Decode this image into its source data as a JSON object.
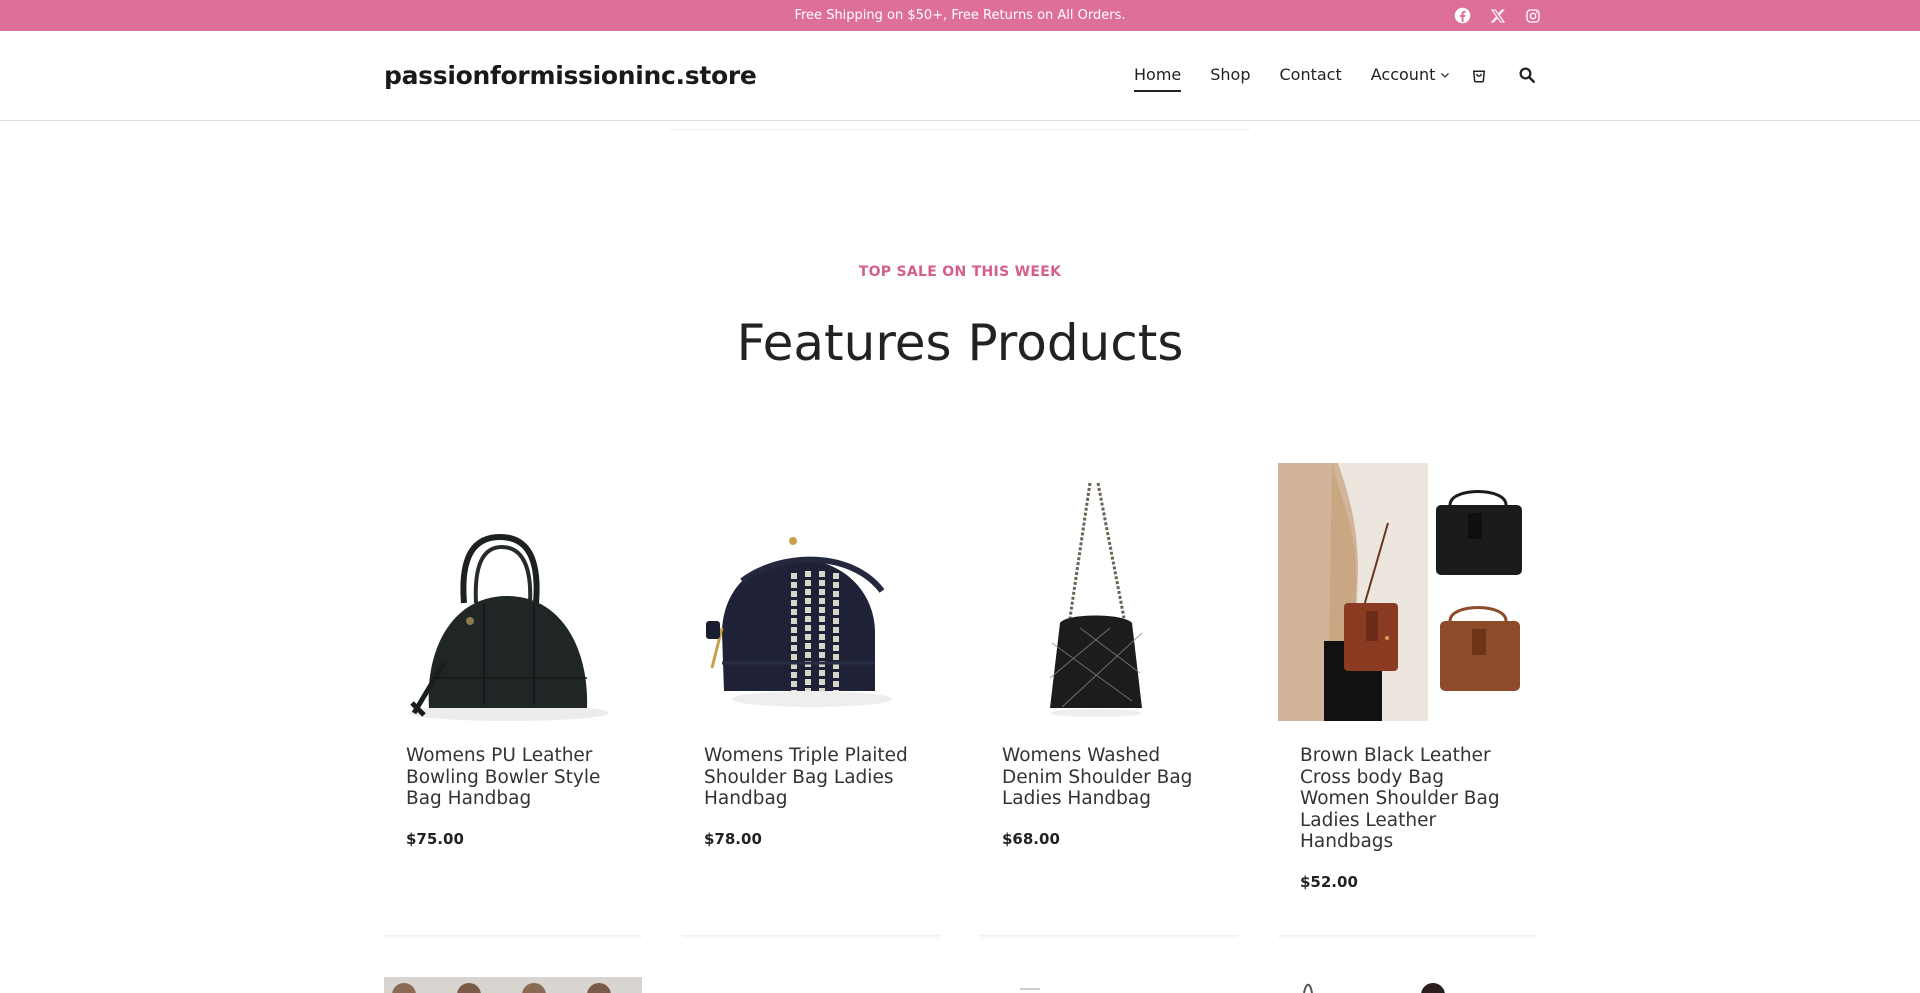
{
  "topbar": {
    "announcement": "Free Shipping on $50+, Free Returns on All Orders.",
    "social": [
      "facebook-icon",
      "x-twitter-icon",
      "instagram-icon"
    ],
    "bg_color": "#dd6f99"
  },
  "header": {
    "logo": "passionformissioninc.store",
    "nav": [
      {
        "label": "Home",
        "active": true
      },
      {
        "label": "Shop",
        "active": false
      },
      {
        "label": "Contact",
        "active": false
      },
      {
        "label": "Account",
        "active": false
      }
    ],
    "icons": [
      "cart-icon",
      "search-icon"
    ]
  },
  "section": {
    "eyebrow": "TOP SALE ON THIS WEEK",
    "heading": "Features Products",
    "accent_color": "#d65e8c"
  },
  "products": [
    {
      "title": "Womens PU Leather Bowling Bowler Style Bag Handbag",
      "price": "$75.00"
    },
    {
      "title": "Womens Triple Plaited Shoulder Bag Ladies Handbag",
      "price": "$78.00"
    },
    {
      "title": "Womens Washed Denim Shoulder Bag Ladies Handbag",
      "price": "$68.00"
    },
    {
      "title": "Brown Black Leather Cross body Bag Women Shoulder Bag Ladies Leather Handbags",
      "price": "$52.00"
    }
  ]
}
